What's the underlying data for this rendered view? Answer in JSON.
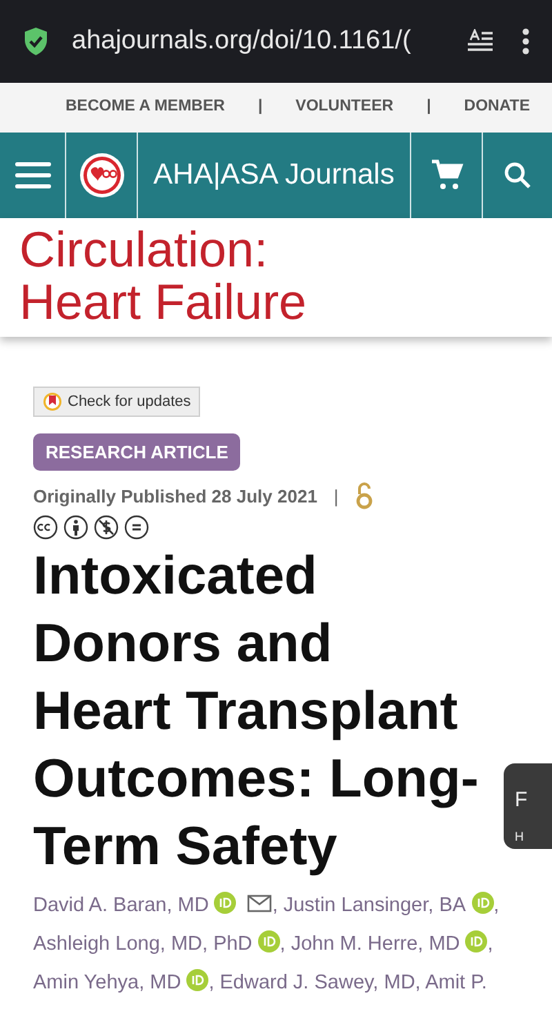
{
  "browser": {
    "url": "ahajournals.org/doi/10.1161/(",
    "secure": true
  },
  "top_links": [
    {
      "label": "BECOME A MEMBER"
    },
    {
      "label": "VOLUNTEER"
    },
    {
      "label": "DONATE"
    }
  ],
  "top_links_separator": "|",
  "navbar": {
    "brand": "AHA|ASA Journals"
  },
  "journal_title": [
    "Circulation:",
    "Heart Failure"
  ],
  "check_updates": "Check for updates",
  "article_type": "RESEARCH ARTICLE",
  "published": "Originally Published 28 July 2021",
  "published_separator": "|",
  "open_access": true,
  "title_lines": [
    "Intoxicated",
    "Donors and",
    "Heart Transplant",
    "Outcomes: Long-",
    "Term Safety"
  ],
  "author_lines": [
    [
      {
        "name": "David A. Baran, MD",
        "orcid": true,
        "email": true,
        "separator": ","
      },
      {
        "name": "Justin Lansinger, BA",
        "orcid": true,
        "email": false,
        "separator": ","
      }
    ],
    [
      {
        "name": "Ashleigh Long, MD, PhD",
        "orcid": true,
        "email": false,
        "separator": ","
      },
      {
        "name": "John M. Herre, MD",
        "orcid": true,
        "email": false,
        "separator": ","
      }
    ],
    [
      {
        "name": "Amin Yehya, MD",
        "orcid": true,
        "email": false,
        "separator": ","
      },
      {
        "name": "Edward J. Sawey, MD,",
        "orcid": false,
        "email": false
      },
      {
        "name": "Amit P.",
        "orcid": false,
        "email": false
      }
    ]
  ],
  "floating_panel": {
    "line_1": "F",
    "line_2": "H"
  }
}
